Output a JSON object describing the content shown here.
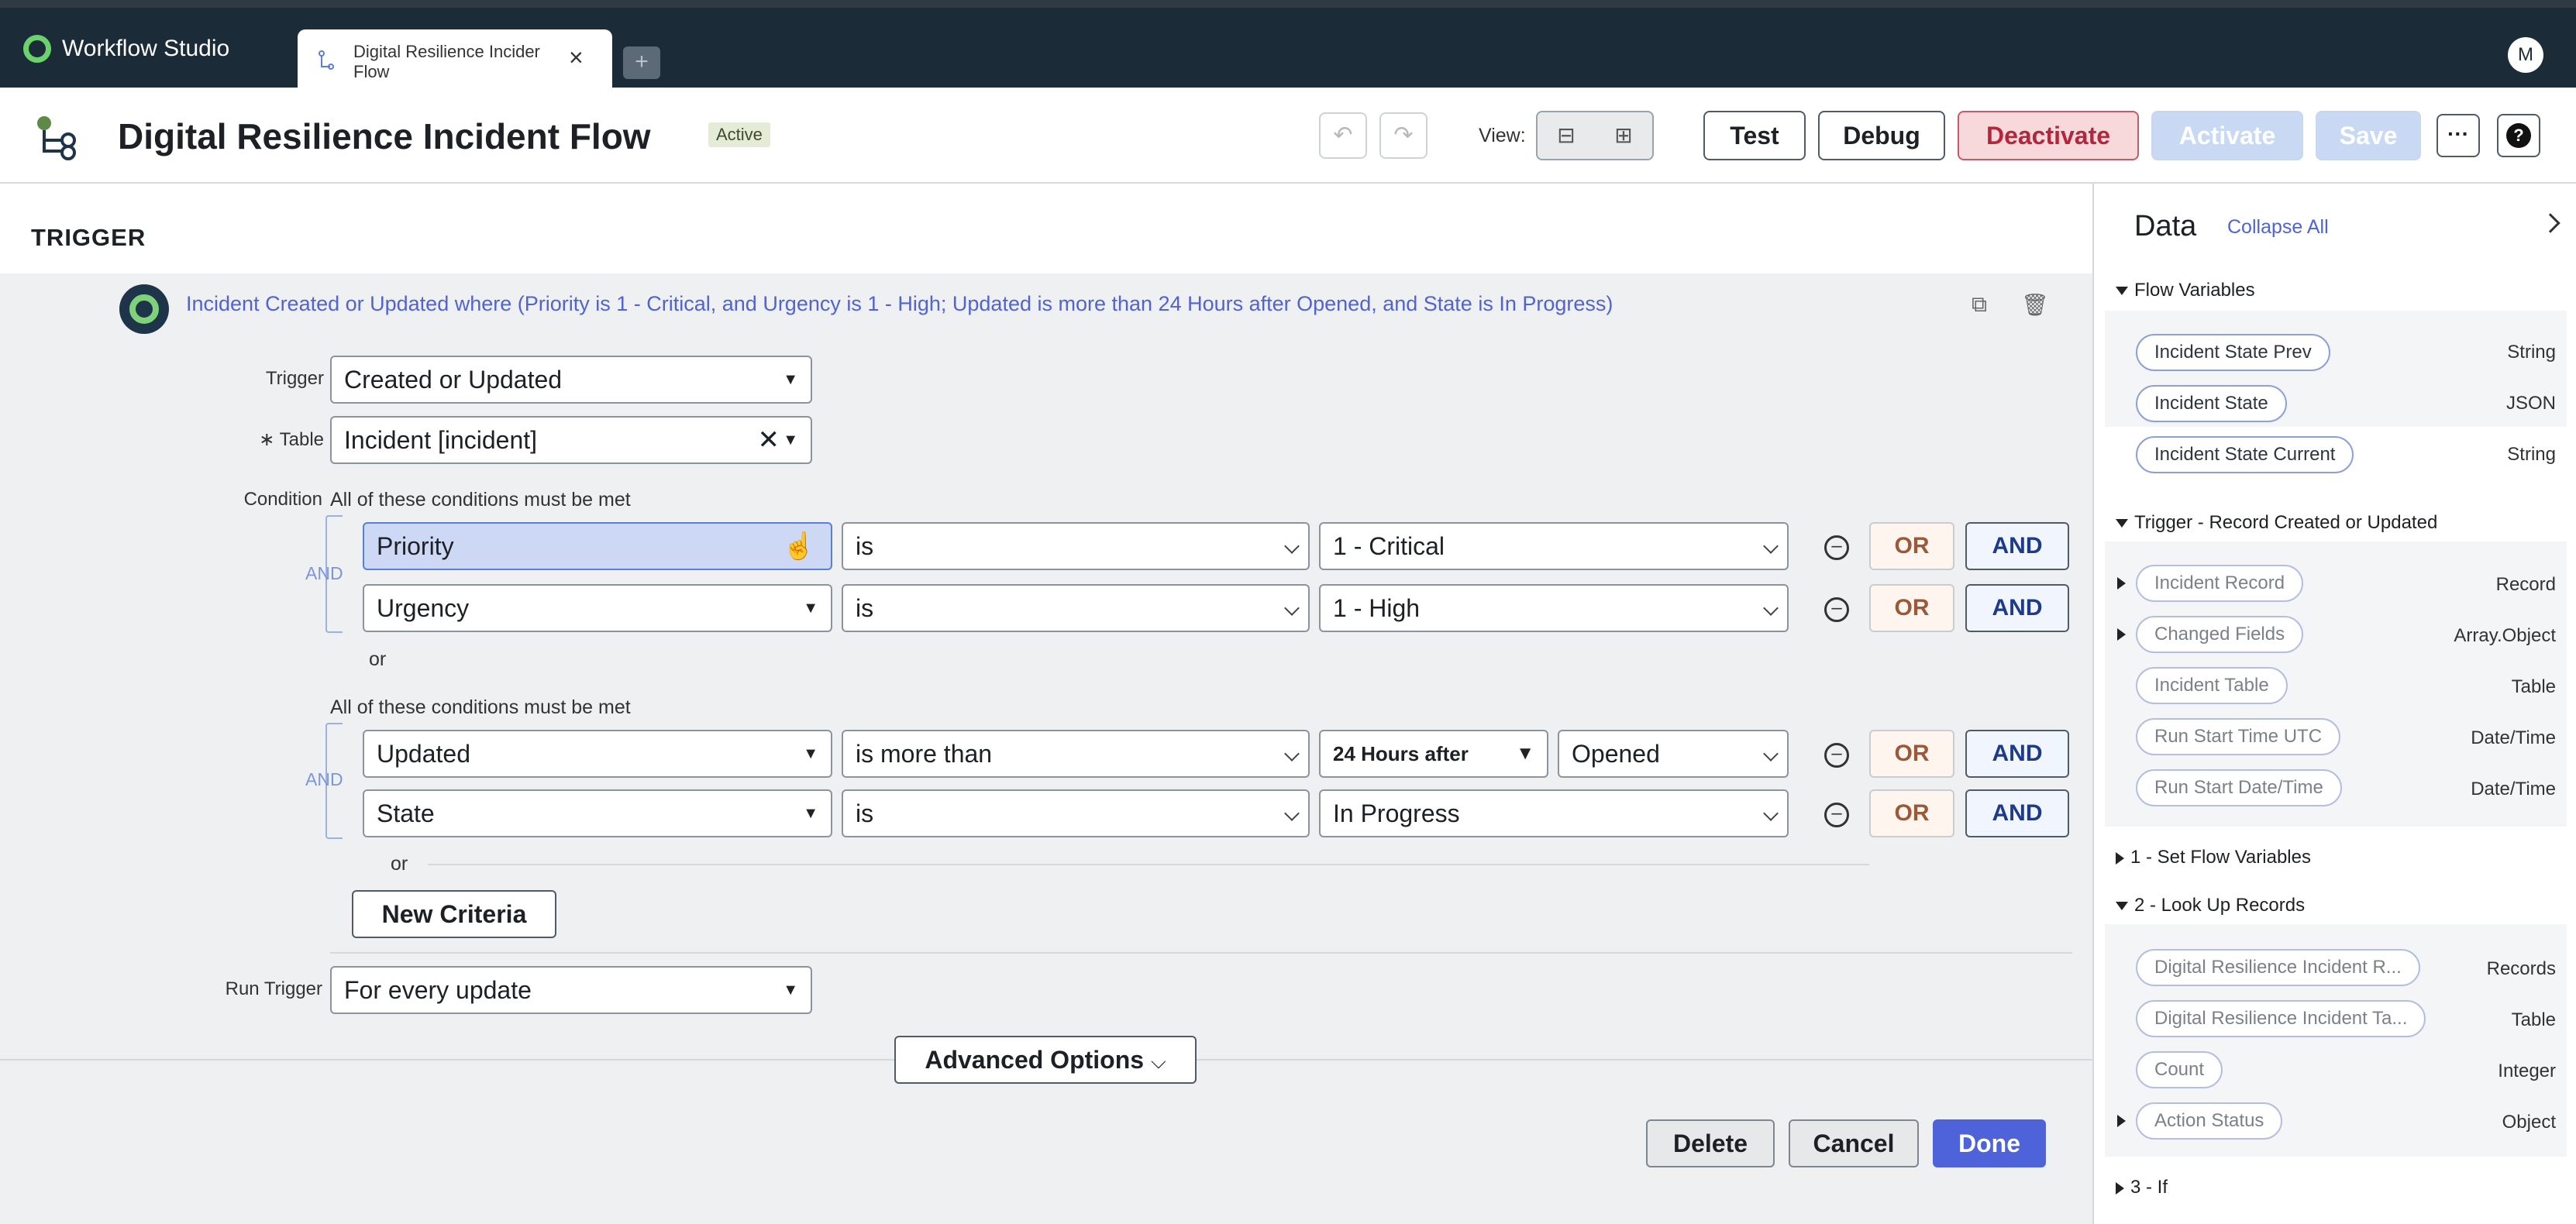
{
  "app": {
    "name": "Workflow Studio",
    "avatar_initial": "M"
  },
  "tab": {
    "title_line1": "Digital Resilience Incider",
    "title_line2": "Flow"
  },
  "header": {
    "title": "Digital Resilience Incident Flow",
    "status": "Active",
    "view_label": "View:",
    "buttons": {
      "test": "Test",
      "debug": "Debug",
      "deactivate": "Deactivate",
      "activate": "Activate",
      "save": "Save",
      "more": "···",
      "help": "?"
    }
  },
  "trigger": {
    "heading": "TRIGGER",
    "summary": "Incident Created or Updated where (Priority is 1 - Critical, and Urgency is 1 - High; Updated is more than 24 Hours after Opened, and State is In Progress)",
    "trigger_label": "Trigger",
    "trigger_value": "Created or Updated",
    "table_label": "Table",
    "table_required": "∗",
    "table_value": "Incident [incident]",
    "condition_label": "Condition",
    "group_label": "All of these conditions must be met",
    "and_label": "AND",
    "or_label": "or",
    "or_btn": "OR",
    "and_btn": "AND",
    "rows": [
      {
        "field": "Priority",
        "operator": "is",
        "value": "1 - Critical"
      },
      {
        "field": "Urgency",
        "operator": "is",
        "value": "1 - High"
      },
      {
        "field": "Updated",
        "operator": "is more than",
        "qualifier": "24 Hours after",
        "value": "Opened"
      },
      {
        "field": "State",
        "operator": "is",
        "value": "In Progress"
      }
    ],
    "new_criteria": "New Criteria",
    "run_trigger_label": "Run Trigger",
    "run_trigger_value": "For every update",
    "advanced": "Advanced Options",
    "delete": "Delete",
    "cancel": "Cancel",
    "done": "Done"
  },
  "data_panel": {
    "title": "Data",
    "collapse_all": "Collapse All",
    "sections": {
      "flow_vars": "Flow Variables",
      "trigger": "Trigger - Record Created or Updated",
      "set_vars": "1 - Set Flow Variables",
      "lookup": "2 - Look Up Records",
      "if": "3 - If"
    },
    "flow_vars": [
      {
        "name": "Incident State Prev",
        "type": "String"
      },
      {
        "name": "Incident State",
        "type": "JSON"
      },
      {
        "name": "Incident State Current",
        "type": "String"
      }
    ],
    "trigger_items": [
      {
        "name": "Incident Record",
        "type": "Record"
      },
      {
        "name": "Changed Fields",
        "type": "Array.Object"
      },
      {
        "name": "Incident Table",
        "type": "Table"
      },
      {
        "name": "Run Start Time UTC",
        "type": "Date/Time"
      },
      {
        "name": "Run Start Date/Time",
        "type": "Date/Time"
      }
    ],
    "lookup_items": [
      {
        "name": "Digital Resilience Incident R...",
        "type": "Records"
      },
      {
        "name": "Digital Resilience Incident Ta...",
        "type": "Table"
      },
      {
        "name": "Count",
        "type": "Integer"
      },
      {
        "name": "Action Status",
        "type": "Object"
      }
    ]
  }
}
